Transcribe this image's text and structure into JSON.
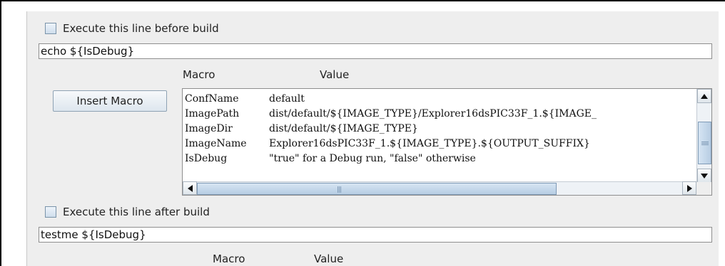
{
  "before_build": {
    "checkbox_label": "Execute this line before build",
    "command": "echo ${IsDebug}"
  },
  "macro_table": {
    "col_macro": "Macro",
    "col_value": "Value",
    "insert_button": "Insert Macro",
    "rows": [
      {
        "macro": "ConfName",
        "value": "default"
      },
      {
        "macro": "ImagePath",
        "value": "dist/default/${IMAGE_TYPE}/Explorer16dsPIC33F_1.${IMAGE_"
      },
      {
        "macro": "ImageDir",
        "value": "dist/default/${IMAGE_TYPE}"
      },
      {
        "macro": "ImageName",
        "value": "Explorer16dsPIC33F_1.${IMAGE_TYPE}.${OUTPUT_SUFFIX}"
      },
      {
        "macro": "IsDebug",
        "value": "\"true\" for a Debug run, \"false\" otherwise"
      }
    ]
  },
  "after_build": {
    "checkbox_label": "Execute this line after build",
    "command": "testme ${IsDebug}",
    "col_macro": "Macro",
    "col_value": "Value"
  },
  "icons": {
    "scroll_up": "arrow-up-icon",
    "scroll_down": "arrow-down-icon",
    "scroll_left": "arrow-left-icon",
    "scroll_right": "arrow-right-icon"
  },
  "colors": {
    "panel_bg": "#eeeeee",
    "scroll_thumb": "#b7cde3",
    "field_border": "#8e8e8e"
  }
}
